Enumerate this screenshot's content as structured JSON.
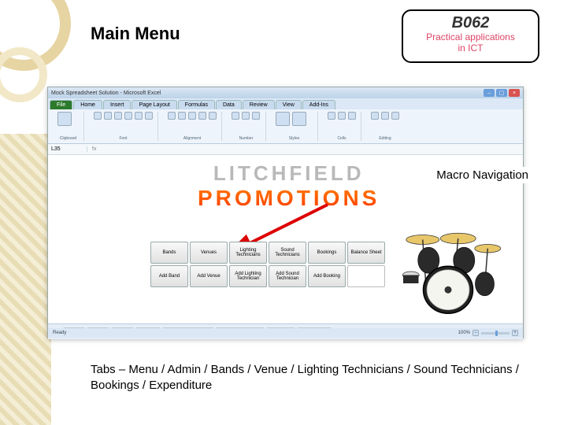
{
  "slide": {
    "title": "Main Menu",
    "callout": "Macro Navigation",
    "caption": "Tabs – Menu / Admin / Bands / Venue / Lighting Technicians / Sound Technicians / Bookings / Expenditure"
  },
  "badge": {
    "code": "B062",
    "line1": "Practical applications",
    "line2": "in ICT"
  },
  "excel": {
    "title": "Mock Spreadsheet Solution - Microsoft Excel",
    "cellref": "L35",
    "status_left": "Ready",
    "zoom": "100%",
    "tabs": [
      "File",
      "Home",
      "Insert",
      "Page Layout",
      "Formulas",
      "Data",
      "Review",
      "View",
      "Add-Ins"
    ],
    "ribbon_groups": [
      "Clipboard",
      "Font",
      "Alignment",
      "Number",
      "Styles",
      "Cells",
      "Editing"
    ],
    "sheet_tabs": [
      "Menu",
      "Admin",
      "Bands",
      "Venues",
      "Lighting Technicians",
      "Sound Technicians",
      "Bookings",
      "Expenditure"
    ],
    "logo_line1": "LITCHFIELD",
    "logo_line2": "PROMOTIONS",
    "buttons_row1": [
      "Bands",
      "Venues",
      "Lighting Technicians",
      "Sound Technicians",
      "Bookings",
      "Balance Sheet"
    ],
    "buttons_row2": [
      "Add Band",
      "Add Venue",
      "Add Lighting Technician",
      "Add Sound Technician",
      "Add Booking",
      ""
    ]
  }
}
